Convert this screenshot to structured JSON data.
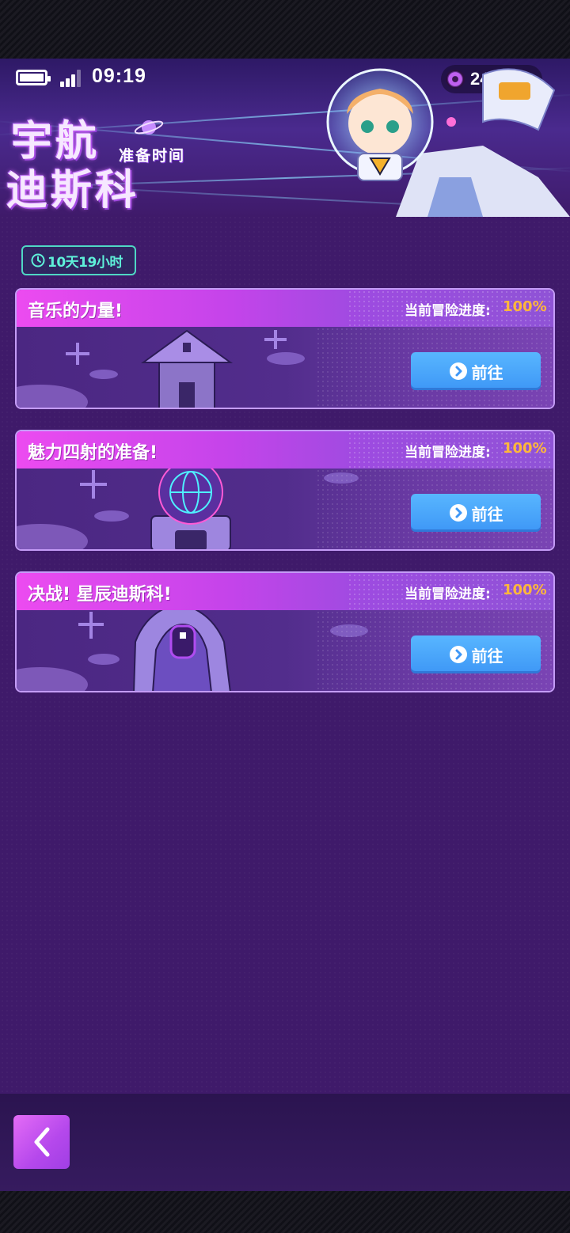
{
  "status_bar": {
    "time": "09:19",
    "coin_count": "24"
  },
  "banner": {
    "logo_line1": "宇航",
    "logo_line2": "迪斯科",
    "logo_subtitle": "准备时间"
  },
  "timer": {
    "text": "10天19小时"
  },
  "cards": [
    {
      "title": "音乐的力量!",
      "progress_label": "当前冒险进度:",
      "progress_value": "100%",
      "progress_fraction": 1.0,
      "button_label": "前往",
      "scene_icon": "pixel-castle-icon"
    },
    {
      "title": "魅力四射的准备!",
      "progress_label": "当前冒险进度:",
      "progress_value": "100%",
      "progress_fraction": 1.0,
      "button_label": "前往",
      "scene_icon": "pixel-globe-tower-icon"
    },
    {
      "title": "决战!  星辰迪斯科!",
      "progress_label": "当前冒险进度:",
      "progress_value": "100%",
      "progress_fraction": 1.0,
      "button_label": "前往",
      "scene_icon": "pixel-rocket-gate-icon"
    }
  ],
  "navigation": {
    "back_icon": "chevron-left-icon"
  },
  "colors": {
    "background": "#3f1a6a",
    "card_header_start": "#ec4bf0",
    "progress_value": "#ffb73a",
    "go_button": "#4aa8ff",
    "timer_accent": "#4fd8c4",
    "back_button": "#c850ee"
  }
}
